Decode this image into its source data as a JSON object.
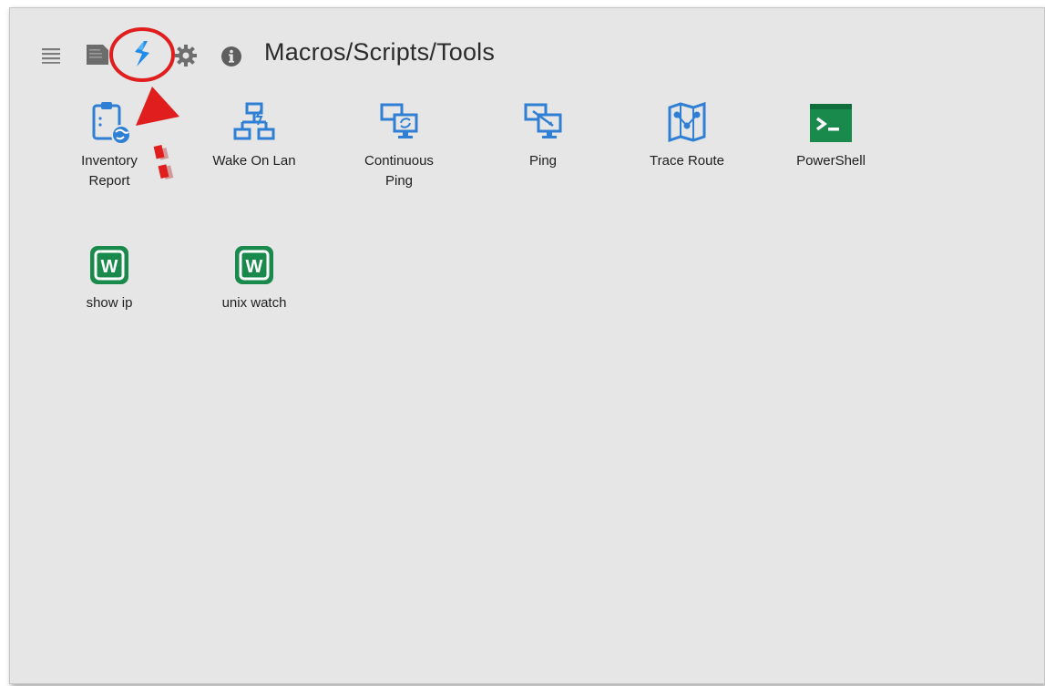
{
  "header": {
    "title": "Macros/Scripts/Tools",
    "icons": [
      "menu-icon",
      "document-icon",
      "macros-icon",
      "gear-icon",
      "info-icon"
    ]
  },
  "tools": [
    {
      "label": "Inventory Report",
      "icon": "inventory-report-icon"
    },
    {
      "label": "Wake On Lan",
      "icon": "wake-on-lan-icon"
    },
    {
      "label": "Continuous Ping",
      "icon": "continuous-ping-icon"
    },
    {
      "label": "Ping",
      "icon": "ping-icon"
    },
    {
      "label": "Trace Route",
      "icon": "trace-route-icon"
    },
    {
      "label": "PowerShell",
      "icon": "powershell-icon"
    },
    {
      "label": "show ip",
      "icon": "w-script-icon"
    },
    {
      "label": "unix watch",
      "icon": "w-script-icon"
    }
  ],
  "colors": {
    "accent_blue": "#2f7fd4",
    "script_green": "#1a8a4c",
    "annotation_red": "#e01e1e",
    "panel_bg": "#e6e6e6"
  }
}
